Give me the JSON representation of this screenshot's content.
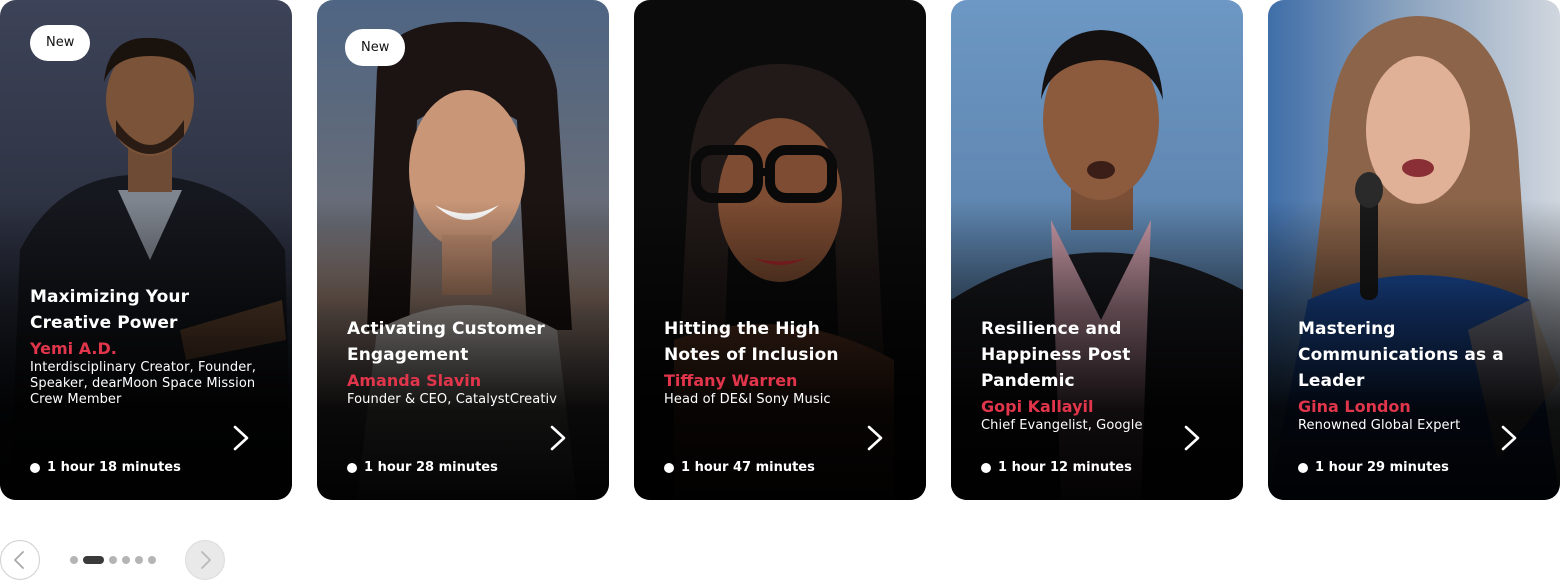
{
  "cards": [
    {
      "badge": "New",
      "title": "Maximizing Your Creative Power",
      "speaker": "Yemi A.D.",
      "role": "Interdisciplinary Creator,  Founder, Speaker, dearMoon Space Mission Crew Member",
      "duration": "1 hour 18 minutes"
    },
    {
      "badge": "New",
      "title": "Activating Customer Engagement",
      "speaker": "Amanda Slavin",
      "role": "Founder & CEO, CatalystCreativ",
      "duration": "1 hour 28 minutes"
    },
    {
      "title": "Hitting the High Notes of Inclusion",
      "speaker": "Tiffany Warren",
      "role": "Head of DE&I Sony Music",
      "duration": "1 hour 47 minutes"
    },
    {
      "title": "Resilience and Happiness Post Pandemic",
      "speaker": "Gopi Kallayil",
      "role": "Chief Evangelist, Google",
      "duration": "1 hour 12 minutes"
    },
    {
      "title": "Mastering Communications as a Leader",
      "speaker": "Gina London",
      "role": "Renowned Global Expert",
      "duration": "1 hour 29 minutes"
    }
  ],
  "pagination": {
    "pages": 6,
    "active_page": 2
  },
  "colors": {
    "speaker_accent": "#e0354b",
    "badge_bg": "#ffffff",
    "active_dot": "#3a3a3a",
    "inactive_dot": "#b5b5b5"
  },
  "icons": {
    "card_next": "chevron-right-icon",
    "carousel_prev": "arrow-left-icon",
    "carousel_next": "arrow-right-icon",
    "duration": "dot-icon"
  }
}
